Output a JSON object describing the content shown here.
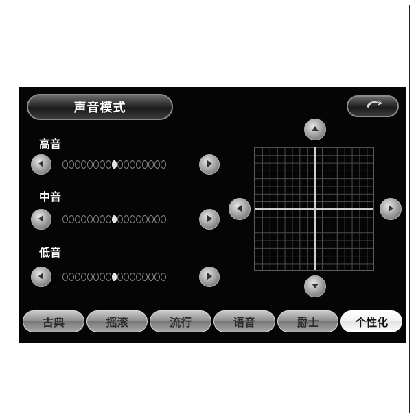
{
  "header": {
    "title": "声音模式"
  },
  "bands": [
    {
      "label": "高音",
      "level_index": 8,
      "steps": 17
    },
    {
      "label": "中音",
      "level_index": 8,
      "steps": 17
    },
    {
      "label": "低音",
      "level_index": 8,
      "steps": 17
    }
  ],
  "presets": [
    {
      "label": "古典"
    },
    {
      "label": "摇滚"
    },
    {
      "label": "流行"
    },
    {
      "label": "语音"
    },
    {
      "label": "爵士"
    },
    {
      "label": "个性化"
    }
  ],
  "active_preset_index": 5,
  "icons": {
    "back": "return-arrow-icon",
    "left": "arrow-left-icon",
    "right": "arrow-right-icon",
    "up": "arrow-up-icon",
    "down": "arrow-down-icon"
  }
}
